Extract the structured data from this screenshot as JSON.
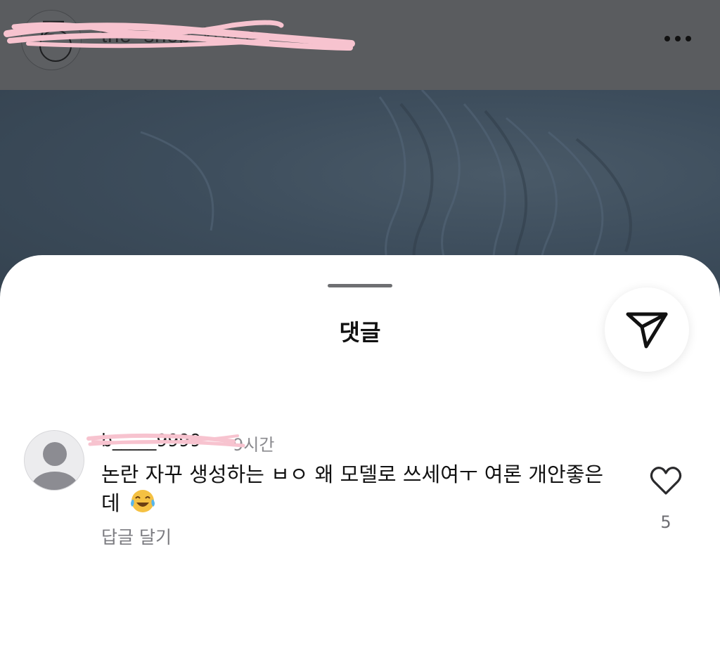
{
  "post_header": {
    "username": "the_shop_korea",
    "more_icon": "more-horizontal-icon"
  },
  "comments_sheet": {
    "title": "댓글",
    "share_icon": "paper-plane-icon"
  },
  "comment": {
    "username": "b_____9999",
    "time": "9시간",
    "text": "논란 자꾸 생성하는 ㅂㅇ 왜 모델로 쓰세여ㅜ 여론 개안좋은데",
    "emoji": "😂",
    "reply_label": "답글 달기",
    "like_count": "5",
    "like_icon": "heart-outline-icon",
    "avatar_icon": "default-avatar-icon"
  },
  "colors": {
    "header_overlay": "#5a5c5f",
    "scribble": "#f7b8c8",
    "text_primary": "#111111",
    "text_secondary": "#7b7b80"
  }
}
